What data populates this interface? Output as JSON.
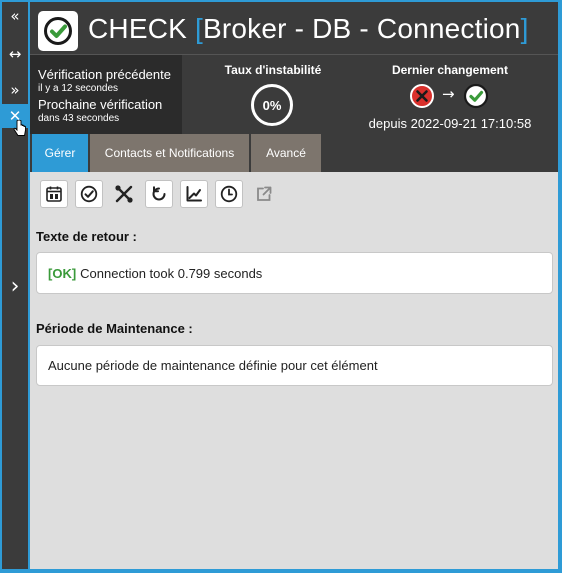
{
  "rail": {
    "collapse_glyph": "«",
    "resize_glyph": "↔",
    "expand_glyph": "»",
    "close_glyph": "✕",
    "next_glyph": "›"
  },
  "header": {
    "check": "CHECK",
    "open_bracket": "[",
    "name": "Broker - DB - Connection",
    "close_bracket": "]"
  },
  "info": {
    "previous_label": "Vérification précédente",
    "previous_value": "il y a 12 secondes",
    "next_label": "Prochaine vérification",
    "next_value": "dans 43 secondes",
    "instability_label": "Taux d'instabilité",
    "instability_value": "0%",
    "last_change_label": "Dernier changement",
    "last_change_since": "depuis 2022-09-21 17:10:58",
    "arrow": "→"
  },
  "tabs": [
    {
      "label": "Gérer"
    },
    {
      "label": "Contacts et Notifications"
    },
    {
      "label": "Avancé"
    }
  ],
  "toolbar": {
    "icons": [
      "calendar-icon",
      "check-circle-icon",
      "tools-icon",
      "refresh-icon",
      "graph-icon",
      "clock-icon",
      "external-link-icon"
    ]
  },
  "output": {
    "label": "Texte de retour :",
    "status": "[OK]",
    "text": "Connection took 0.799 seconds"
  },
  "maintenance": {
    "label": "Période de Maintenance :",
    "text": "Aucune période de maintenance définie pour cet élément"
  },
  "colors": {
    "accent": "#2e9bd6",
    "dark": "#3b3b3b",
    "ok_green": "#3a9a3a",
    "critical_red": "#d9302c"
  }
}
